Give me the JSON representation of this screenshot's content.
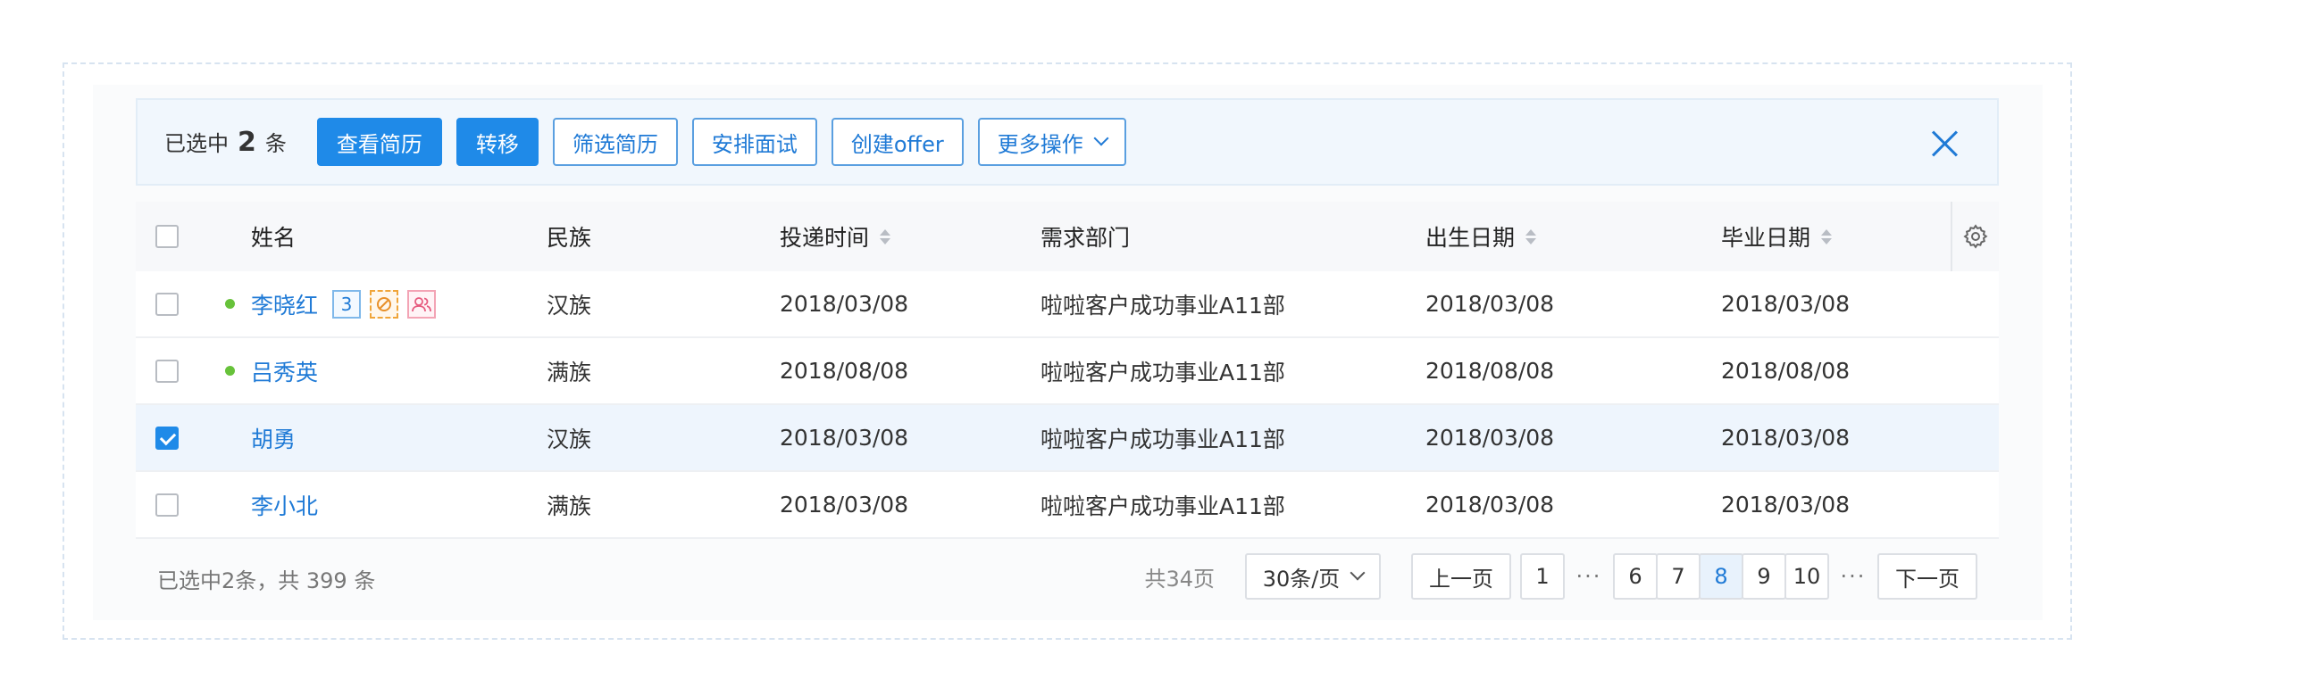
{
  "toolbar": {
    "selected_prefix": "已选中",
    "selected_count": "2",
    "selected_suffix": "条",
    "buttons": {
      "view_resume": "查看简历",
      "transfer": "转移",
      "filter_resume": "筛选简历",
      "schedule_interview": "安排面试",
      "create_offer": "创建offer",
      "more_actions": "更多操作"
    }
  },
  "table": {
    "columns": {
      "name": "姓名",
      "ethnicity": "民族",
      "submit_time": "投递时间",
      "department": "需求部门",
      "birth_date": "出生日期",
      "graduation_date": "毕业日期"
    },
    "rows": [
      {
        "name": "李晓红",
        "tag_count": "3",
        "ethnicity": "汉族",
        "submit_time": "2018/03/08",
        "department": "啦啦客户成功事业A11部",
        "birth_date": "2018/03/08",
        "graduation_date": "2018/03/08"
      },
      {
        "name": "吕秀英",
        "ethnicity": "满族",
        "submit_time": "2018/08/08",
        "department": "啦啦客户成功事业A11部",
        "birth_date": "2018/08/08",
        "graduation_date": "2018/08/08"
      },
      {
        "name": "胡勇",
        "ethnicity": "汉族",
        "submit_time": "2018/03/08",
        "department": "啦啦客户成功事业A11部",
        "birth_date": "2018/03/08",
        "graduation_date": "2018/03/08"
      },
      {
        "name": "李小北",
        "ethnicity": "满族",
        "submit_time": "2018/03/08",
        "department": "啦啦客户成功事业A11部",
        "birth_date": "2018/03/08",
        "graduation_date": "2018/03/08"
      }
    ]
  },
  "footer": {
    "summary": "已选中2条，共 399 条",
    "total_pages": "共34页",
    "page_size": "30条/页",
    "prev": "上一页",
    "next": "下一页",
    "first_page": "1",
    "ellipsis": "···",
    "pages": [
      "6",
      "7",
      "8",
      "9",
      "10"
    ]
  },
  "colors": {
    "primary": "#1f8ae8",
    "status_online": "#67c23a"
  }
}
